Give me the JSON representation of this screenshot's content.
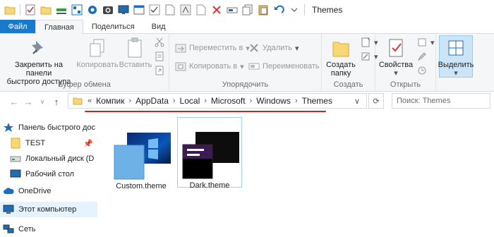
{
  "window": {
    "title": "Themes"
  },
  "tabs": {
    "file": "Файл",
    "home": "Главная",
    "share": "Поделиться",
    "view": "Вид"
  },
  "ribbon": {
    "pin": {
      "line1": "Закрепить на панели",
      "line2": "быстрого доступа"
    },
    "copy": "Копировать",
    "paste": "Вставить",
    "clipboard_group": "Буфер обмена",
    "move_to": "Переместить в",
    "copy_to": "Копировать в",
    "delete": "Удалить",
    "rename": "Переименовать",
    "organize_group": "Упорядочить",
    "new_folder": {
      "line1": "Создать",
      "line2": "папку"
    },
    "create_group": "Создать",
    "properties": "Свойства",
    "open_group": "Открыть",
    "select": "Выделить"
  },
  "address": {
    "prefix": "«",
    "segments": [
      "Компик",
      "AppData",
      "Local",
      "Microsoft",
      "Windows",
      "Themes"
    ],
    "search_placeholder": "Поиск: Themes"
  },
  "navpane": {
    "quick_access": "Панель быстрого дос",
    "test": "TEST",
    "local_disk": "Локальный диск (D",
    "desktop": "Рабочий стол",
    "onedrive": "OneDrive",
    "this_pc": "Этот компьютер",
    "network": "Сеть"
  },
  "files": [
    {
      "name": "Custom.theme"
    },
    {
      "name": "Dark.theme"
    }
  ],
  "colors": {
    "accent": "#1979ca",
    "highlight": "#e01b1b"
  }
}
